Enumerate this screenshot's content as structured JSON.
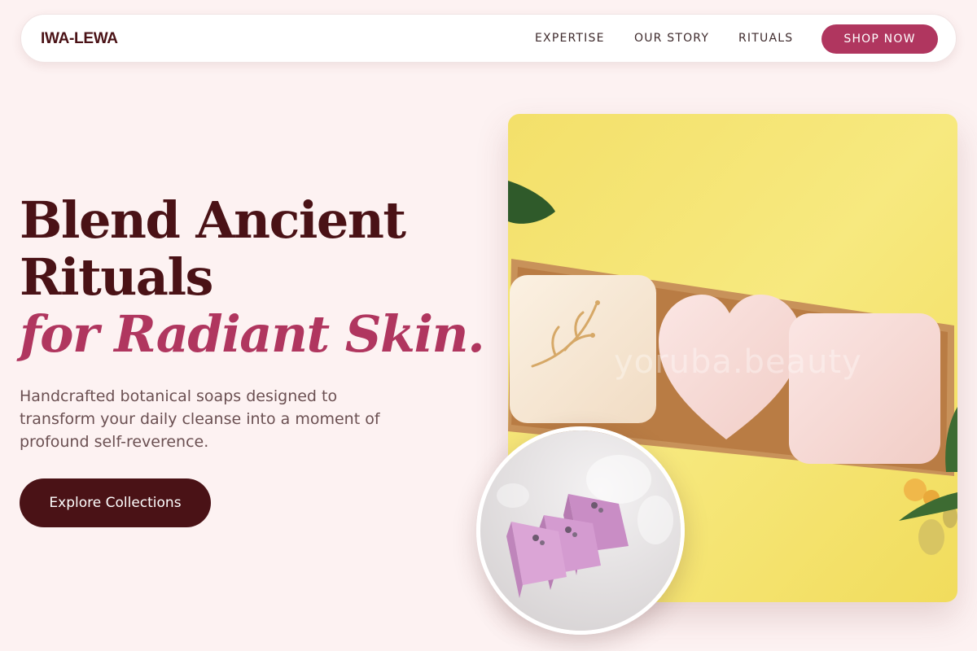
{
  "nav": {
    "brand": "IWA-LEWA",
    "links": [
      "EXPERTISE",
      "OUR STORY",
      "RITUALS"
    ],
    "cta_label": "SHOP NOW"
  },
  "hero": {
    "headline_line1": "Blend Ancient",
    "headline_line2": "Rituals",
    "headline_accent": "for Radiant Skin.",
    "subcopy": "Handcrafted botanical soaps designed to transform your daily cleanse into a moment of profound self-reverence.",
    "cta_label": "Explore Collections"
  },
  "media": {
    "main_image": "soap-gift-box-photo",
    "watermark": "yoruba.beauty",
    "inset_image": "lavender-soap-bars-photo"
  },
  "colors": {
    "background": "#fdf2f2",
    "primary_dark": "#4a1216",
    "accent": "#b0365f",
    "body_text": "#6b5052"
  }
}
